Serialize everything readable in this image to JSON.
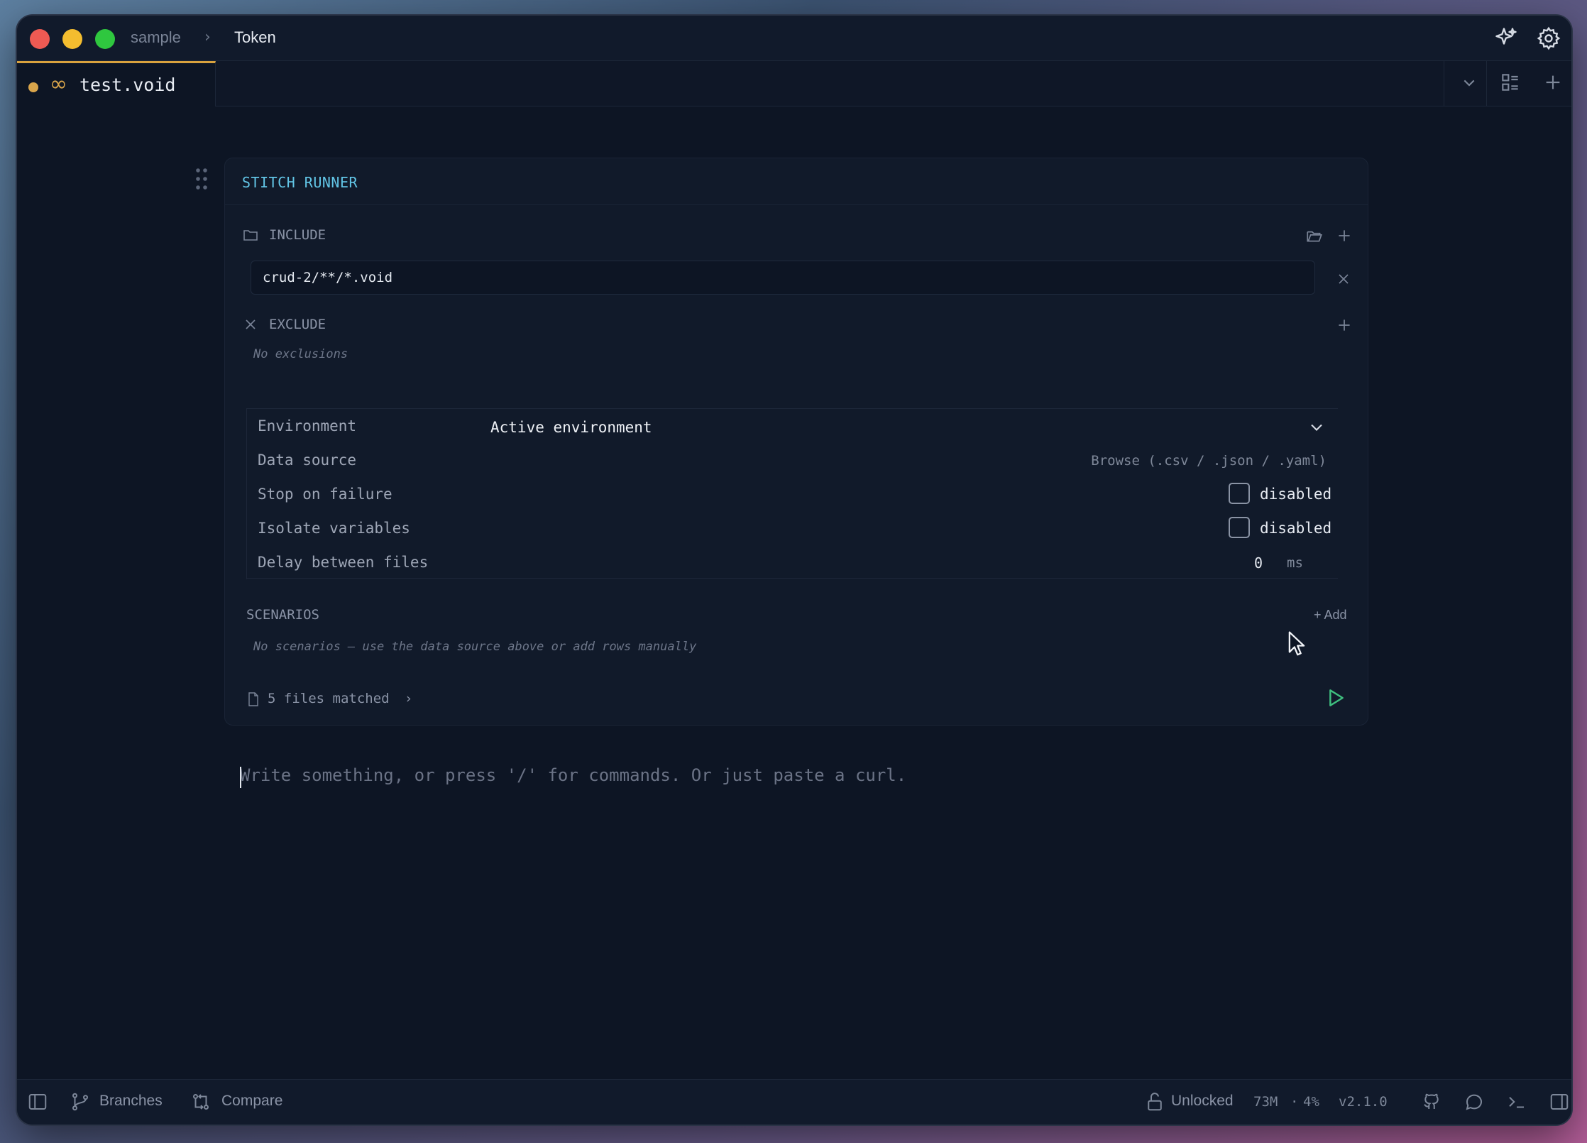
{
  "titlebar": {
    "breadcrumb": [
      "sample",
      "Token"
    ],
    "icons": [
      "sparkle-icon",
      "gear-icon"
    ]
  },
  "tab": {
    "name": "test.void",
    "modified_dot_color": "#d9a54b",
    "infinity_glyph": "∞"
  },
  "tabbar_icons": [
    "chevron-down-icon",
    "layout-icon",
    "plus-icon"
  ],
  "runner": {
    "title": "STITCH RUNNER",
    "include": {
      "label": "INCLUDE",
      "patterns": [
        "crud-2/**/*.void"
      ]
    },
    "exclude": {
      "label": "EXCLUDE",
      "empty_text": "No exclusions"
    },
    "settings": {
      "environment_label": "Environment",
      "environment_value": "Active environment",
      "data_source_label": "Data source",
      "data_source_action": "Browse (.csv / .json / .yaml)",
      "stop_on_failure_label": "Stop on failure",
      "stop_on_failure_state": "disabled",
      "isolate_label": "Isolate variables",
      "isolate_state": "disabled",
      "delay_label": "Delay between files",
      "delay_value": "0",
      "delay_unit": "ms"
    },
    "scenarios": {
      "label": "SCENARIOS",
      "add_label": "Add",
      "empty_text": "No scenarios — use the data source above or add rows manually"
    },
    "files_matched": "5 files matched",
    "accent_color": "#62c5e6",
    "run_color": "#3fbf7f"
  },
  "editor": {
    "placeholder": "Write something, or press '/' for commands. Or just paste a curl."
  },
  "statusbar": {
    "branches": "Branches",
    "compare": "Compare",
    "lock_state": "Unlocked",
    "memory": "73M",
    "separator": "·",
    "cpu": "4%",
    "version": "v2.1.0"
  }
}
